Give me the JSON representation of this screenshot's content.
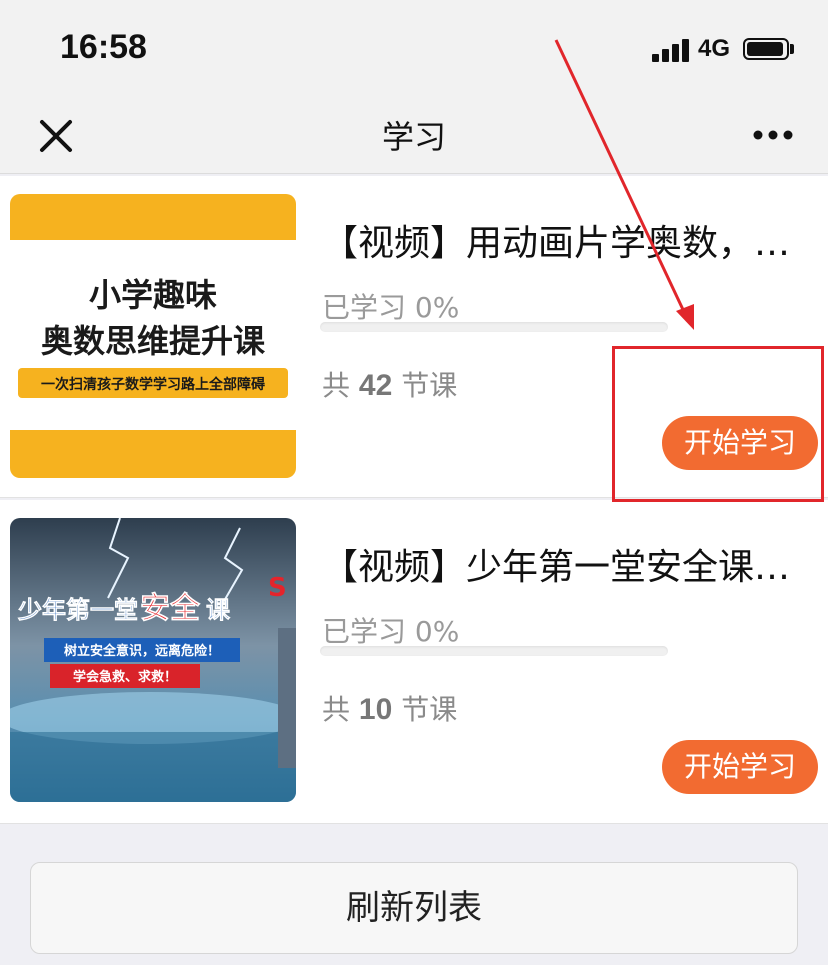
{
  "status_bar": {
    "time": "16:58",
    "network": "4G",
    "signal_icon": "signal-bars-icon",
    "battery_icon": "battery-icon"
  },
  "nav": {
    "title": "学习",
    "close_icon": "close-icon",
    "more_icon": "more-icon"
  },
  "courses": [
    {
      "title": "【视频】用动画片学奥数，学习数学思维",
      "progress_label": "已学习 0%",
      "progress": 0,
      "lesson_prefix": "共",
      "lesson_count": "42",
      "lesson_suffix": "节课",
      "button_label": "开始学习",
      "thumbnail": {
        "line1": "小学趣味",
        "line2": "奥数思维提升课",
        "line3": "一次扫清孩子数学学习路上全部障碍"
      }
    },
    {
      "title": "【视频】少年第一堂安全课：树立安全意识",
      "progress_label": "已学习 0%",
      "progress": 0,
      "lesson_prefix": "共",
      "lesson_count": "10",
      "lesson_suffix": "节课",
      "button_label": "开始学习",
      "thumbnail": {
        "title_part1": "少年第一堂",
        "title_part2": "安全",
        "title_part3": "课",
        "line2": "树立安全意识，远离危险！",
        "line3": "学会急救、求救！",
        "corner": "S"
      }
    }
  ],
  "refresh_label": "刷新列表",
  "colors": {
    "accent": "#f26b31",
    "annotation": "#e1262b",
    "thumb1_yellow": "#f6b21f"
  }
}
